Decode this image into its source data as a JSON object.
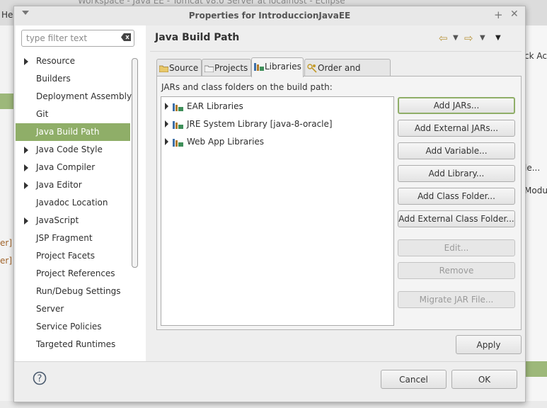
{
  "background": {
    "menu_label": "He",
    "title_fragment": "Workspace - Java EE - Tomcat v8.0 Server at localhost - Eclipse",
    "left_markers": [
      "er]",
      "er]"
    ],
    "right_labels": [
      "ck Ac",
      "le...",
      "Modul"
    ]
  },
  "dialog": {
    "title": "Properties for IntroduccionJavaEE",
    "filter_placeholder": "type filter text",
    "nav_items": [
      {
        "label": "Resource",
        "expandable": true,
        "selected": false
      },
      {
        "label": "Builders",
        "expandable": false,
        "selected": false
      },
      {
        "label": "Deployment Assembly",
        "expandable": false,
        "selected": false
      },
      {
        "label": "Git",
        "expandable": false,
        "selected": false
      },
      {
        "label": "Java Build Path",
        "expandable": false,
        "selected": true
      },
      {
        "label": "Java Code Style",
        "expandable": true,
        "selected": false
      },
      {
        "label": "Java Compiler",
        "expandable": true,
        "selected": false
      },
      {
        "label": "Java Editor",
        "expandable": true,
        "selected": false
      },
      {
        "label": "Javadoc Location",
        "expandable": false,
        "selected": false
      },
      {
        "label": "JavaScript",
        "expandable": true,
        "selected": false
      },
      {
        "label": "JSP Fragment",
        "expandable": false,
        "selected": false
      },
      {
        "label": "Project Facets",
        "expandable": false,
        "selected": false
      },
      {
        "label": "Project References",
        "expandable": false,
        "selected": false
      },
      {
        "label": "Run/Debug Settings",
        "expandable": false,
        "selected": false
      },
      {
        "label": "Server",
        "expandable": false,
        "selected": false
      },
      {
        "label": "Service Policies",
        "expandable": false,
        "selected": false
      },
      {
        "label": "Targeted Runtimes",
        "expandable": false,
        "selected": false
      }
    ],
    "page_title": "Java Build Path",
    "tabs": [
      {
        "label": "Source",
        "active": false
      },
      {
        "label": "Projects",
        "active": false
      },
      {
        "label": "Libraries",
        "active": true
      },
      {
        "label": "Order and Export",
        "active": false
      }
    ],
    "panel_label": "JARs and class folders on the build path:",
    "libraries": [
      {
        "label": "EAR Libraries"
      },
      {
        "label": "JRE System Library [java-8-oracle]"
      },
      {
        "label": "Web App Libraries"
      }
    ],
    "buttons": [
      {
        "label": "Add JARs...",
        "enabled": true,
        "focused": true
      },
      {
        "label": "Add External JARs...",
        "enabled": true
      },
      {
        "label": "Add Variable...",
        "enabled": true
      },
      {
        "label": "Add Library...",
        "enabled": true
      },
      {
        "label": "Add Class Folder...",
        "enabled": true
      },
      {
        "label": "Add External Class Folder...",
        "enabled": true
      },
      {
        "label": "Edit...",
        "enabled": false
      },
      {
        "label": "Remove",
        "enabled": false
      },
      {
        "label": "Migrate JAR File...",
        "enabled": false
      }
    ],
    "apply_label": "Apply",
    "cancel_label": "Cancel",
    "ok_label": "OK",
    "help_symbol": "?",
    "colors": {
      "selection": "#8fae68",
      "nav_arrow": "#b9963f"
    }
  }
}
